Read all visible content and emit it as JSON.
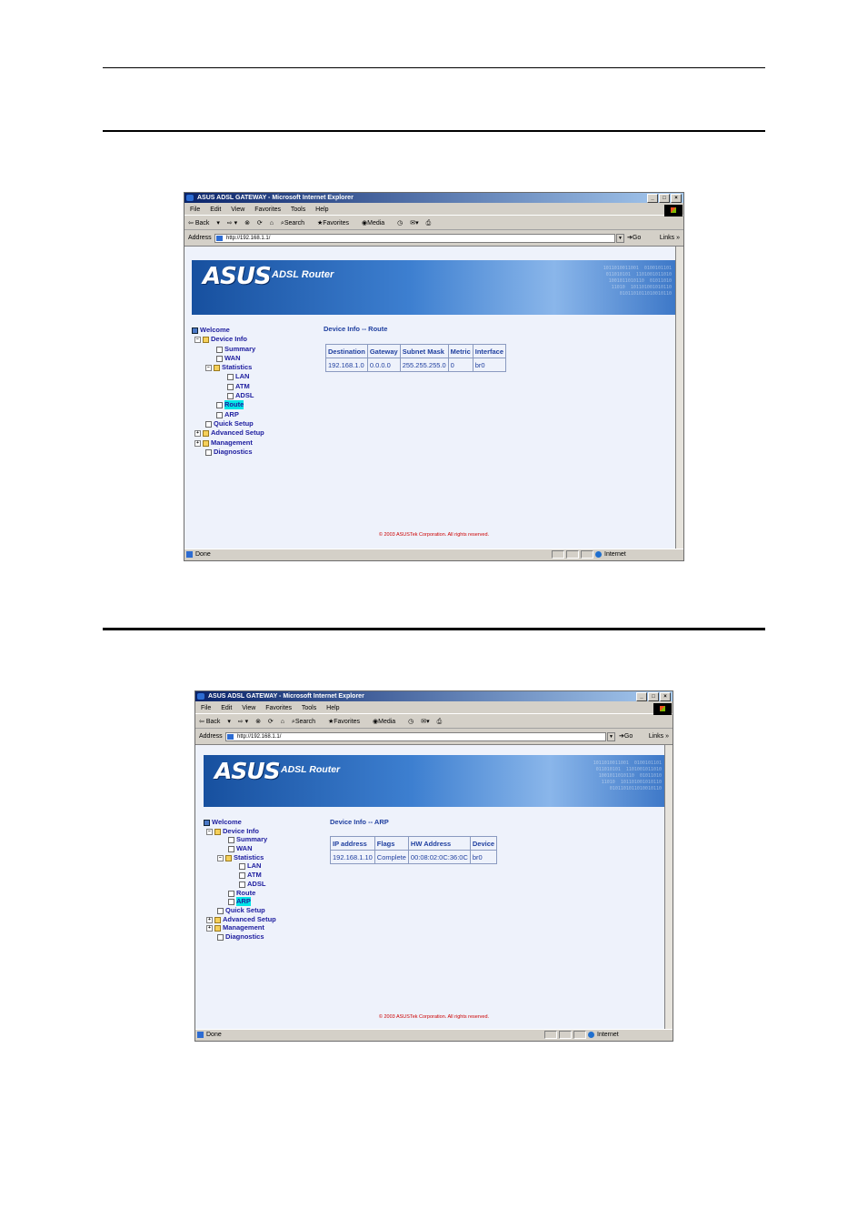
{
  "window": {
    "title": "ASUS ADSL GATEWAY - Microsoft Internet Explorer",
    "menu": [
      "File",
      "Edit",
      "View",
      "Favorites",
      "Tools",
      "Help"
    ],
    "toolbar": [
      "Back",
      "Search",
      "Favorites",
      "Media"
    ],
    "address_label": "Address",
    "address_url": "http://192.168.1.1/",
    "go_label": "Go",
    "links_label": "Links",
    "status_text": "Done",
    "zone_text": "Internet"
  },
  "banner": {
    "logo": "ASUS",
    "product": "ADSL Router"
  },
  "nav_tree": {
    "welcome": "Welcome",
    "device_info": "Device Info",
    "summary": "Summary",
    "wan": "WAN",
    "statistics": "Statistics",
    "lan": "LAN",
    "atm": "ATM",
    "adsl": "ADSL",
    "route": "Route",
    "arp": "ARP",
    "quick_setup": "Quick Setup",
    "advanced_setup": "Advanced Setup",
    "management": "Management",
    "diagnostics": "Diagnostics"
  },
  "route_screen": {
    "heading": "Device Info -- Route",
    "columns": [
      "Destination",
      "Gateway",
      "Subnet Mask",
      "Metric",
      "Interface"
    ],
    "row": [
      "192.168.1.0",
      "0.0.0.0",
      "255.255.255.0",
      "0",
      "br0"
    ],
    "selected_item": "Route"
  },
  "arp_screen": {
    "heading": "Device Info -- ARP",
    "columns": [
      "IP address",
      "Flags",
      "HW Address",
      "Device"
    ],
    "row": [
      "192.168.1.10",
      "Complete",
      "00:08:02:0C:36:0C",
      "br0"
    ],
    "selected_item": "ARP"
  },
  "copyright": "© 2003 ASUSTek Corporation. All rights reserved.",
  "colors": {
    "link_text": "#1f3f9f",
    "selected_highlight": "#00e6e6",
    "copyright_text": "#cc0000",
    "titlebar": "#0a246a"
  }
}
